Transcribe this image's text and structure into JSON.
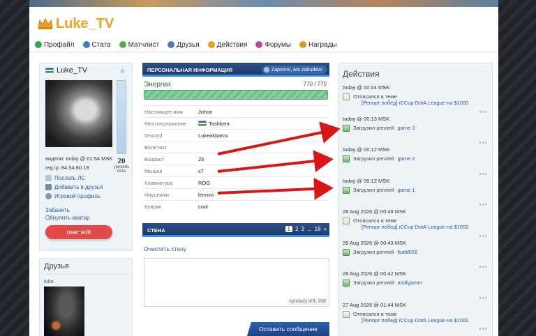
{
  "header": {
    "title": "Luke_TV"
  },
  "nav": [
    {
      "label": "Профайл",
      "color": "#3aa04a"
    },
    {
      "label": "Стата",
      "color": "#3a7fc9"
    },
    {
      "label": "Матчлист",
      "color": "#5aa84a"
    },
    {
      "label": "Друзья",
      "color": "#4a7ab8"
    },
    {
      "label": "Действия",
      "color": "#e0a020"
    },
    {
      "label": "Форумы",
      "color": "#c04a9a"
    },
    {
      "label": "Награды",
      "color": "#d89a20"
    }
  ],
  "profile": {
    "name": "Luke_TV",
    "level": "20",
    "level_label": "уровень dota",
    "seen": "видели: today @ 01:54 MSK",
    "reg_ip": "reg ip: 84.54.80.18",
    "links": [
      "Послать ЛС",
      "Добавить в друзья",
      "Игровой профиль"
    ],
    "sub_links": [
      "Забанить",
      "Обнулить аватар"
    ],
    "edit_button": "user edit"
  },
  "friends": {
    "title": "Друзья",
    "items": [
      {
        "name": "luke"
      }
    ]
  },
  "personal": {
    "header": "ПЕРСОНАЛЬНАЯ ИНФОРМАЦИЯ",
    "status": "Zapomni, Ato zabudew!",
    "energy_label": "Энергия",
    "energy_value": "770 / 770",
    "energy_fraction": 1.0,
    "fields": [
      {
        "key": "Настоящее имя",
        "value": "Johon"
      },
      {
        "key": "Местоположение",
        "value": "Tashkent",
        "flag": true
      },
      {
        "key": "Discord",
        "value": "Lukeakbarov"
      },
      {
        "key": "ВКонтакт",
        "value": ""
      },
      {
        "key": "Возраст",
        "value": "25"
      },
      {
        "key": "Мышка",
        "value": "x7"
      },
      {
        "key": "Клавиатура",
        "value": "ROG"
      },
      {
        "key": "Наушники",
        "value": "lenovo"
      },
      {
        "key": "Коврик",
        "value": "cool"
      }
    ]
  },
  "wall": {
    "header": "СТЕНА",
    "pages": [
      "1",
      "2",
      "3",
      "...",
      "18",
      "»"
    ],
    "clear": "Очистить стену",
    "symbols_left": "symbols left: 200",
    "send_button": "Оставить сообщение"
  },
  "actions": {
    "title": "Действия",
    "items": [
      {
        "time": "today @ 00:24 MSK",
        "type": "post",
        "text": "Отписался в теме",
        "link": "[Репорт побед] iCCup DotA League на $1000"
      },
      {
        "time": "today @ 00:13 MSK",
        "type": "replay",
        "text": "Загрузил реплей",
        "link": "game 3"
      },
      {
        "time": "today @ 00:12 MSK",
        "type": "replay",
        "text": "Загрузил реплей",
        "link": "game 2"
      },
      {
        "time": "today @ 00:12 MSK",
        "type": "replay",
        "text": "Загрузил реплей",
        "link": "game 1"
      },
      {
        "time": "28 Aug 2026 @ 00:48 MSK",
        "type": "post",
        "text": "Отписался в теме",
        "link": "[Репорт побед] iCCup DotA League на $1000"
      },
      {
        "time": "28 Aug 2026 @ 00:43 MSK",
        "type": "replay",
        "text": "Загрузил реплей",
        "link": "fsafdf2f2"
      },
      {
        "time": "28 Aug 2026 @ 00:42 MSK",
        "type": "replay",
        "text": "Загрузил реплей",
        "link": "asdfgamer"
      },
      {
        "time": "27 Aug 2026 @ 01:44 MSK",
        "type": "post",
        "text": "Отписался в теме",
        "link": "[Репорт побед] iCCup DotA League на $1000"
      }
    ]
  }
}
